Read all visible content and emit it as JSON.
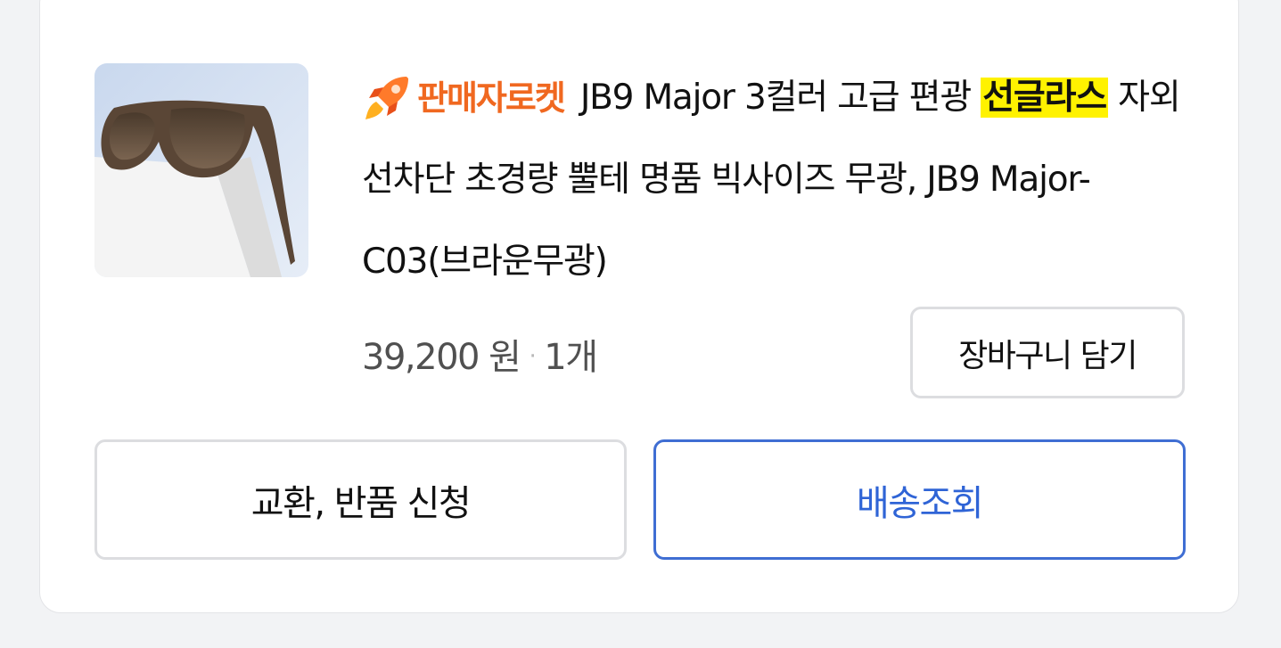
{
  "product": {
    "badge_label": "판매자로켓",
    "badge_icon": "rocket-icon",
    "title_before_highlight": "JB9 Major 3컬러 고급 편광 ",
    "title_highlight": "선글라스",
    "title_after_highlight": " 자외선차단 초경량 뿔테 명품 빅사이즈 무광, JB9 Major-C03(브라운무광)",
    "price": "39,200 원",
    "separator": "·",
    "quantity": "1개",
    "image_alt": "sunglasses-product-image"
  },
  "actions": {
    "add_to_cart": "장바구니 담기",
    "exchange_return": "교환, 반품 신청",
    "track_delivery": "배송조회"
  },
  "colors": {
    "badge_orange": "#f06820",
    "highlight_yellow": "#fff200",
    "accent_blue": "#2f64d6",
    "border_gray": "#dcdde0",
    "background": "#f2f3f5"
  }
}
